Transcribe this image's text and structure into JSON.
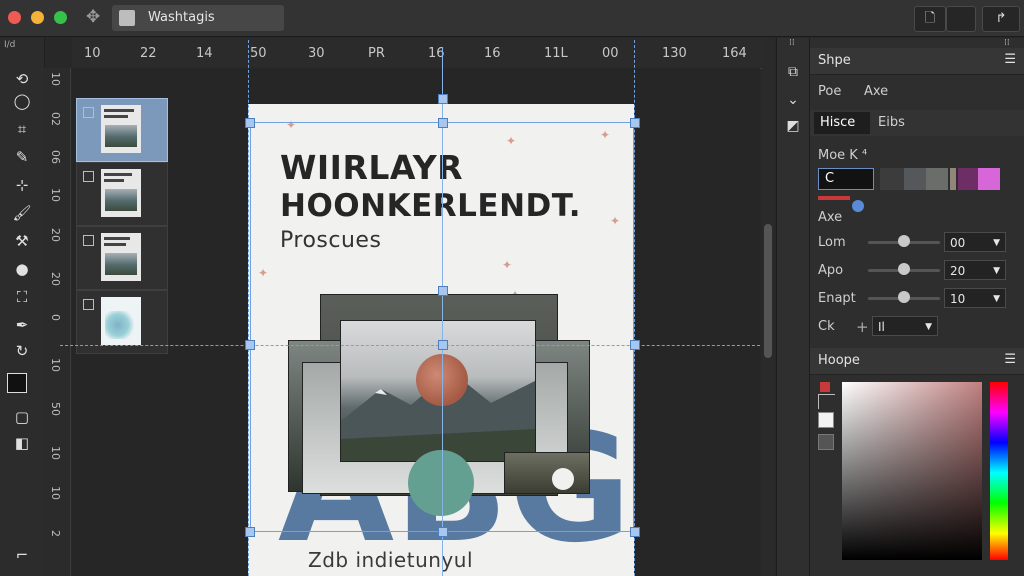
{
  "window": {
    "title": "Washtagis",
    "traffic_colors": [
      "#ee5b55",
      "#f2b33a",
      "#36c24a"
    ]
  },
  "titlebar": {
    "move_icon": "move-arrows-icon",
    "right_buttons": [
      {
        "icon": "document-icon",
        "label": "🗋"
      },
      {
        "icon": "panel-icon",
        "label": ""
      },
      {
        "icon": "expand-icon",
        "label": "↱"
      }
    ]
  },
  "ruler": {
    "corner_label": "I/d",
    "top_ticks": [
      "10",
      "22",
      "14",
      "50",
      "30",
      "PR",
      "16",
      "16",
      "11L",
      "00",
      "130",
      "164"
    ],
    "left_ticks": [
      "10",
      "02",
      "06",
      "10",
      "20",
      "20",
      "0",
      "10",
      "50",
      "10",
      "10",
      "2"
    ]
  },
  "tools": [
    "lasso-icon",
    "crop-icon",
    "eyedropper-icon",
    "healing-icon",
    "brush-icon",
    "stamp-icon",
    "eraser-icon",
    "blur-icon",
    "transform-icon",
    "pen-icon",
    "rotate-icon"
  ],
  "layers": [
    {
      "name": "layer-1",
      "selected": true
    },
    {
      "name": "layer-2",
      "selected": false
    },
    {
      "name": "layer-3",
      "selected": false
    },
    {
      "name": "layer-4",
      "selected": false
    }
  ],
  "artboard": {
    "headline_1": "WIIRLAYR",
    "headline_2": "HOONKERLENDT.",
    "subhead": "Proscues",
    "big_letters": "ABG",
    "footer_text": "Zdb  indietunyul"
  },
  "panels": {
    "shape": {
      "title": "Shpe",
      "tabs_row1": [
        "Poe",
        "Axe"
      ],
      "tabs_row2": [
        "Hisce",
        "Eibs"
      ],
      "mode_label": "Moe K ⁴",
      "mode_value": "C",
      "swatch_colors": [
        "#3c3c3c",
        "#55585a",
        "#6b6d6a",
        "#8f8777",
        "#3a2436",
        "#6d2e66",
        "#d766d9"
      ],
      "axe_label": "Axe",
      "sliders": [
        {
          "label": "Lom",
          "value": "00",
          "level": 0.5
        },
        {
          "label": "Apo",
          "value": "20",
          "level": 0.5
        },
        {
          "label": "Enapt",
          "value": "10",
          "level": 0.5
        }
      ],
      "ck_label": "Ck",
      "ck_value": "Il"
    },
    "hope": {
      "title": "Hoope"
    }
  },
  "colors": {
    "accent": "#5b8bd8",
    "selection_blue": "#7c98bb",
    "guide": "#6ea2e0",
    "shape_red": "#c83a3a"
  }
}
